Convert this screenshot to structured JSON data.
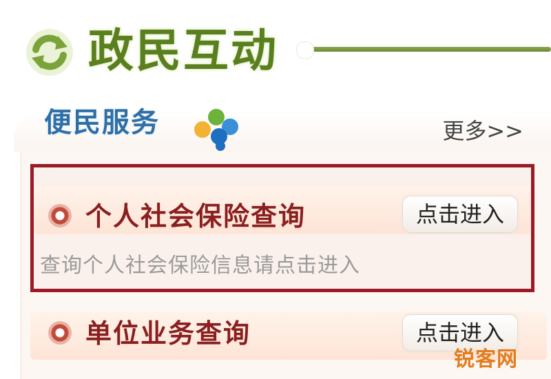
{
  "header": {
    "title": "政民互动",
    "logo_icon": "refresh-arrows-icon"
  },
  "section": {
    "title": "便民服务",
    "icon": "colored-dots-icon",
    "more_link": "更多>>"
  },
  "items": [
    {
      "title": "个人社会保险查询",
      "button": "点击进入",
      "description": "查询个人社会保险信息请点击进入",
      "highlighted": true
    },
    {
      "title": "单位业务查询",
      "button": "点击进入",
      "description": "",
      "highlighted": false
    }
  ],
  "watermark": "锐客网",
  "colors": {
    "header_green": "#5a7f1f",
    "section_blue": "#2e6fa6",
    "item_red": "#8a1f20",
    "highlight_border": "#9a1b27"
  }
}
